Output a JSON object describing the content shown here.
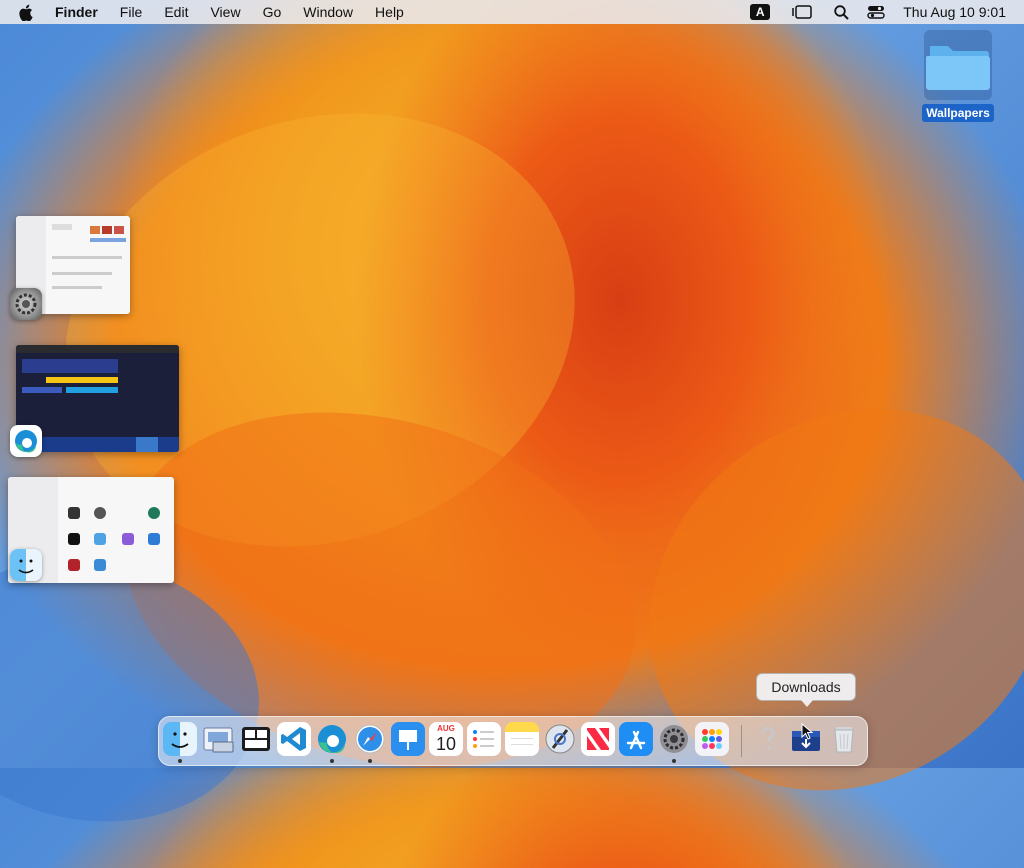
{
  "menubar": {
    "app_name": "Finder",
    "menus": [
      "File",
      "Edit",
      "View",
      "Go",
      "Window",
      "Help"
    ],
    "input_badge": "A",
    "clock": "Thu Aug 10  9:01"
  },
  "desktop": {
    "folder_label": "Wallpapers"
  },
  "stage_manager": {
    "groups": [
      "system-settings",
      "microsoft-edge",
      "finder"
    ]
  },
  "dock": {
    "calendar_month": "AUG",
    "calendar_day": "10",
    "tooltip": "Downloads",
    "items": [
      "finder",
      "preview",
      "mission-control",
      "visual-studio-code",
      "microsoft-edge",
      "safari",
      "keynote",
      "calendar",
      "reminders",
      "notes",
      "xcode-instruments",
      "news",
      "app-store",
      "system-settings",
      "launchpad",
      "help",
      "downloads",
      "trash"
    ]
  }
}
